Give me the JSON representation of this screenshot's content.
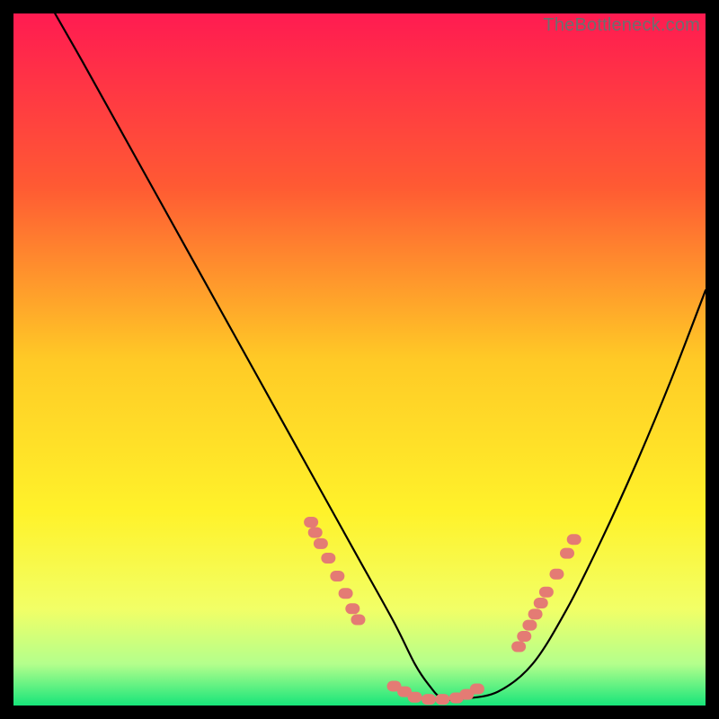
{
  "watermark": "TheBottleneck.com",
  "chart_data": {
    "type": "line",
    "title": "",
    "xlabel": "",
    "ylabel": "",
    "xlim": [
      0,
      100
    ],
    "ylim": [
      0,
      100
    ],
    "gradient_stops": [
      {
        "offset": 0,
        "color": "#ff1b51"
      },
      {
        "offset": 25,
        "color": "#ff5a33"
      },
      {
        "offset": 50,
        "color": "#ffca26"
      },
      {
        "offset": 72,
        "color": "#fff22a"
      },
      {
        "offset": 86,
        "color": "#f2ff66"
      },
      {
        "offset": 94,
        "color": "#b4ff8c"
      },
      {
        "offset": 100,
        "color": "#17e57a"
      }
    ],
    "series": [
      {
        "name": "curve",
        "type": "line",
        "x": [
          6,
          10,
          15,
          20,
          25,
          30,
          35,
          40,
          45,
          50,
          55,
          58,
          60,
          62,
          65,
          70,
          75,
          80,
          85,
          90,
          95,
          100
        ],
        "y": [
          100,
          93,
          84,
          75,
          66,
          57,
          48,
          39,
          30,
          21,
          12,
          6,
          3,
          1,
          1,
          2,
          6,
          14,
          24,
          35,
          47,
          60
        ]
      },
      {
        "name": "left-dot-cluster",
        "type": "scatter",
        "x": [
          43.0,
          43.6,
          44.4,
          45.5,
          46.8,
          48.0,
          49.0,
          49.8
        ],
        "y": [
          26.5,
          25.0,
          23.4,
          21.3,
          18.7,
          16.2,
          14.0,
          12.4
        ]
      },
      {
        "name": "bottom-dot-cluster",
        "type": "scatter",
        "x": [
          55.0,
          56.5,
          58.0,
          60.0,
          62.0,
          64.0,
          65.5,
          67.0
        ],
        "y": [
          2.8,
          2.0,
          1.2,
          0.9,
          0.9,
          1.1,
          1.6,
          2.4
        ]
      },
      {
        "name": "right-dot-cluster",
        "type": "scatter",
        "x": [
          73.0,
          73.8,
          74.6,
          75.4,
          76.2,
          77.0,
          78.5,
          80.0,
          81.0
        ],
        "y": [
          8.5,
          10.0,
          11.6,
          13.2,
          14.8,
          16.4,
          19.0,
          22.0,
          24.0
        ]
      }
    ],
    "marker_color": "#e47b74",
    "curve_color": "#000000"
  }
}
